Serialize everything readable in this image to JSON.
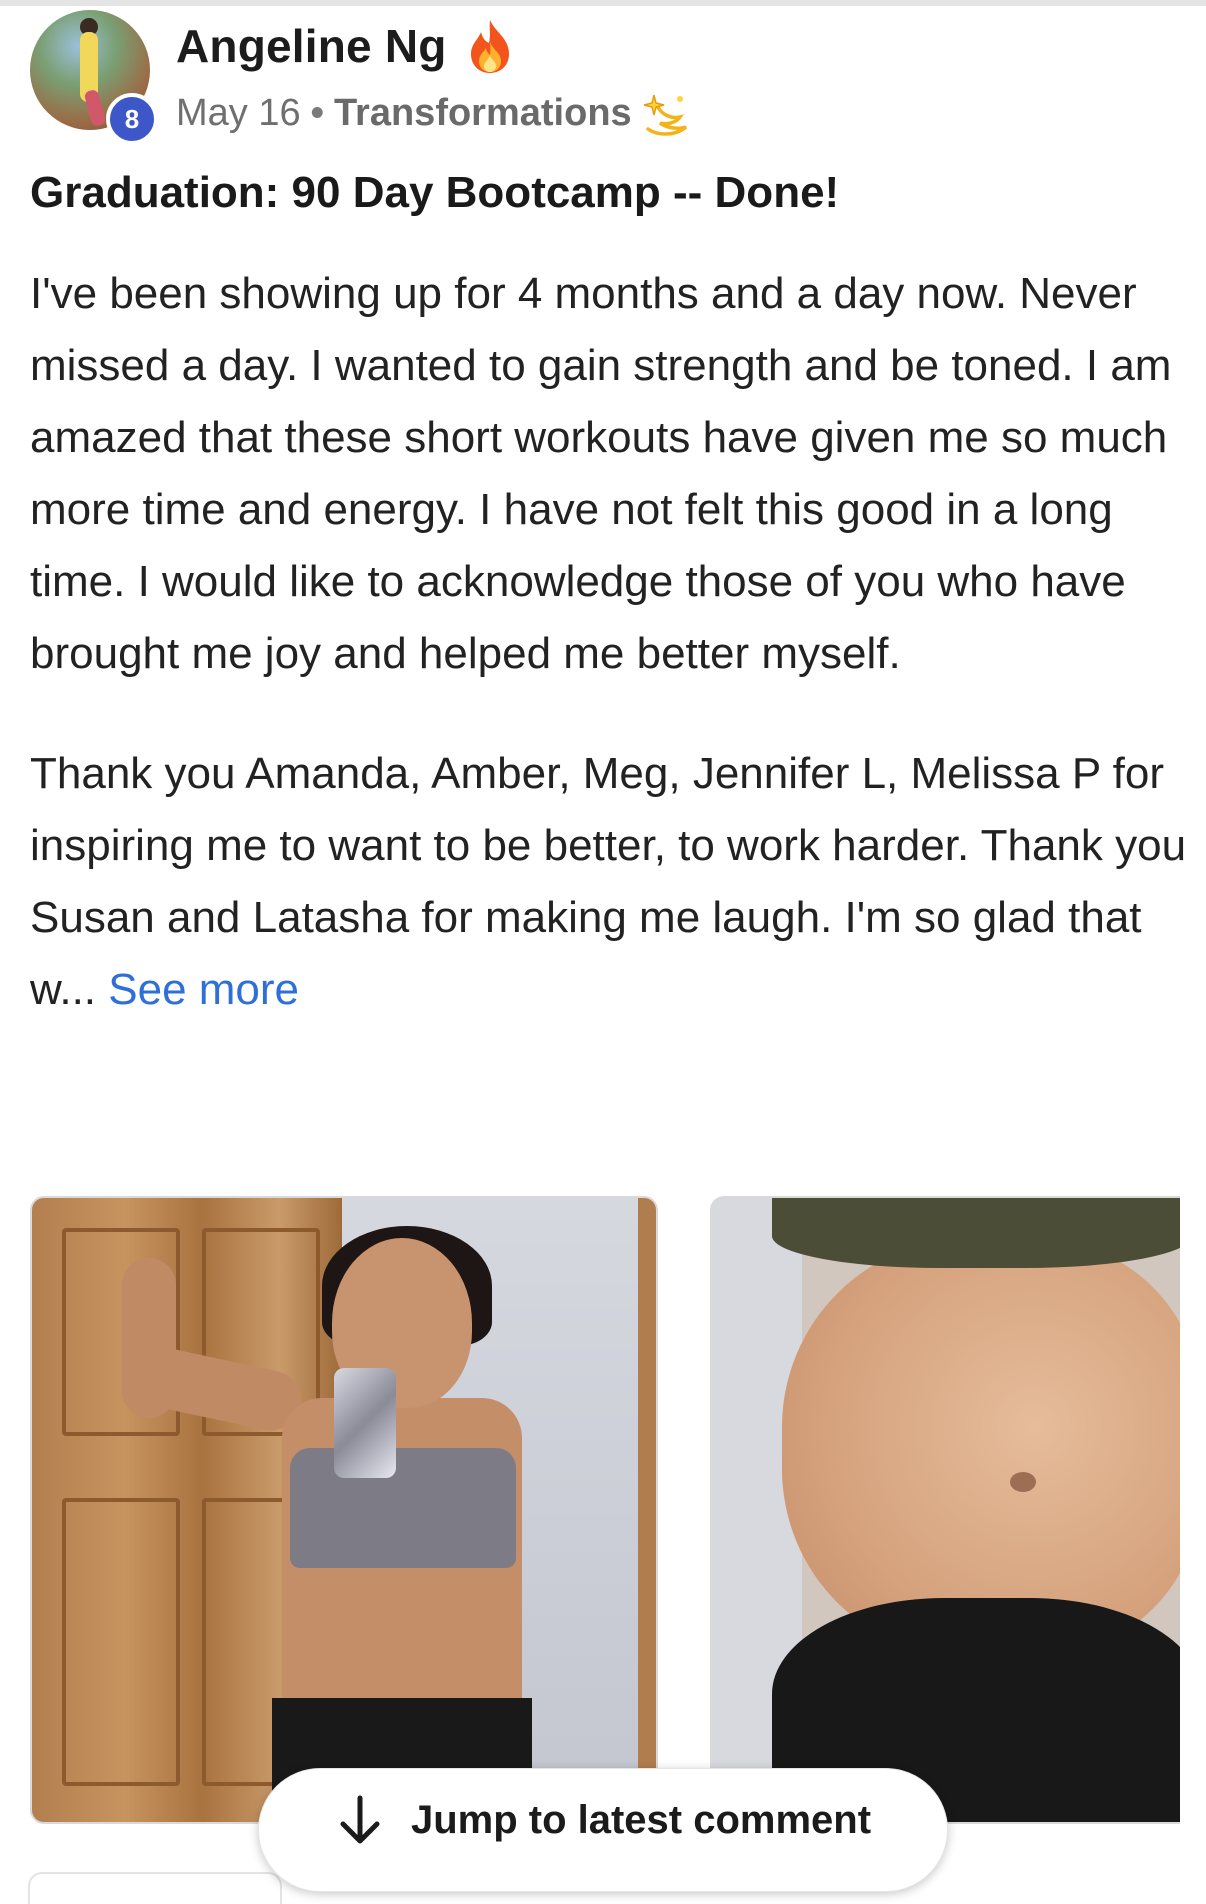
{
  "post": {
    "author": {
      "name": "Angeline Ng",
      "level": "8",
      "avatar_icon": "user-avatar-photo",
      "badge_icon": "fire-icon"
    },
    "date": "May 16",
    "separator": "•",
    "category": "Transformations",
    "category_icon": "sparkle-icon",
    "title": "Graduation: 90 Day Bootcamp -- Done!",
    "paragraphs": [
      "I've been showing up for 4 months and a day now. Never missed a day. I wanted to gain strength and be toned. I am amazed that these short workouts have given me so much more time and energy. I have not felt this good in a long time. I would like to acknowledge those of you who have brought me joy and helped me better myself.",
      "Thank you Amanda, Amber, Meg, Jennifer L, Melissa P for inspiring me to want to be better, to work harder. Thank you Susan and Latasha for making me laugh. I'm so glad that w..."
    ],
    "see_more_label": "See more",
    "photos": [
      {
        "subject": "progress-photo-mirror-selfie"
      },
      {
        "subject": "progress-photo-midsection"
      }
    ]
  },
  "jump_button": {
    "label": "Jump to latest comment",
    "icon": "arrow-down-icon"
  },
  "colors": {
    "link": "#2f6fd8",
    "level_badge": "#3d57c9",
    "text": "#222222",
    "muted": "#6f6f6f"
  }
}
